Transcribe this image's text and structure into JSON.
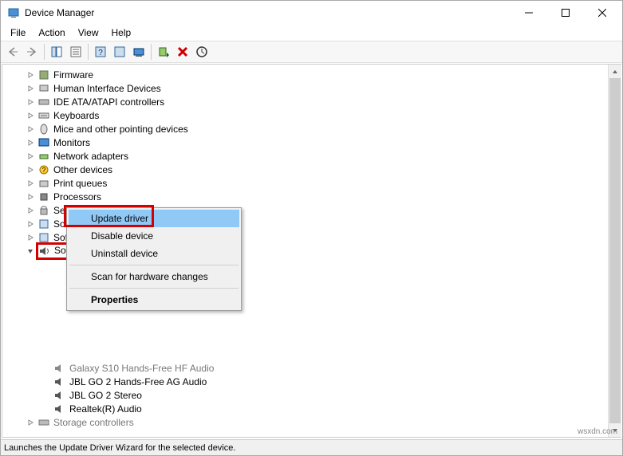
{
  "window": {
    "title": "Device Manager"
  },
  "menubar": [
    "File",
    "Action",
    "View",
    "Help"
  ],
  "tree": {
    "categories": [
      {
        "label": "Firmware",
        "icon": "chip"
      },
      {
        "label": "Human Interface Devices",
        "icon": "hid"
      },
      {
        "label": "IDE ATA/ATAPI controllers",
        "icon": "ide"
      },
      {
        "label": "Keyboards",
        "icon": "keyboard"
      },
      {
        "label": "Mice and other pointing devices",
        "icon": "mouse"
      },
      {
        "label": "Monitors",
        "icon": "monitor"
      },
      {
        "label": "Network adapters",
        "icon": "network"
      },
      {
        "label": "Other devices",
        "icon": "other"
      },
      {
        "label": "Print queues",
        "icon": "printer"
      },
      {
        "label": "Processors",
        "icon": "cpu"
      },
      {
        "label": "Security devices",
        "icon": "security"
      },
      {
        "label": "Software components",
        "icon": "software"
      },
      {
        "label": "Software devices",
        "icon": "software"
      }
    ],
    "expanded_category": {
      "label": "Sound, video and game controllers",
      "children": [
        "Galaxy S10 Hands-Free HF Audio",
        "JBL GO 2 Hands-Free AG Audio",
        "JBL GO 2 Stereo",
        "Realtek(R) Audio"
      ]
    },
    "last_category": {
      "label": "Storage controllers"
    }
  },
  "context_menu": {
    "items": [
      {
        "label": "Update driver",
        "selected": true
      },
      {
        "label": "Disable device",
        "selected": false
      },
      {
        "label": "Uninstall device",
        "selected": false
      }
    ],
    "scan": "Scan for hardware changes",
    "properties": "Properties"
  },
  "statusbar": "Launches the Update Driver Wizard for the selected device.",
  "watermark": "wsxdn.com"
}
